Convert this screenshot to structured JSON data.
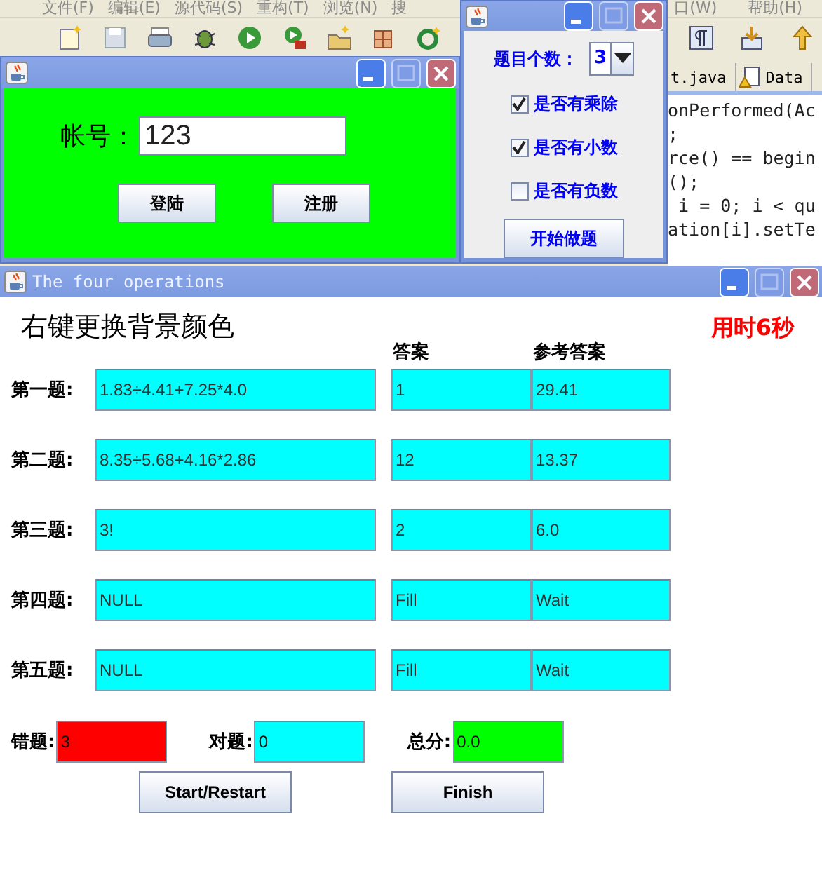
{
  "ide": {
    "menu_left": [
      "文件(F)",
      "编辑(E)",
      "源代码(S)",
      "重构(T)",
      "浏览(N)",
      "搜"
    ],
    "menu_right": [
      "口(W)",
      "帮助(H)"
    ],
    "tabs": [
      "t.java",
      "Data"
    ],
    "code_lines": [
      "onPerformed(Ac",
      ";",
      "rce() == begin",
      "();",
      " i = 0; i < qu",
      "ation[i].setTe"
    ]
  },
  "login_window": {
    "account_label": "帐号：",
    "account_value": "123",
    "buttons": [
      "登陆",
      "注册"
    ]
  },
  "settings_window": {
    "count_label": "题目个数：",
    "count_value": "3",
    "options": [
      {
        "label": "是否有乘除",
        "checked": true
      },
      {
        "label": "是否有小数",
        "checked": true
      },
      {
        "label": "是否有负数",
        "checked": false
      }
    ],
    "start_button": "开始做题"
  },
  "main_window": {
    "title": "The four operations",
    "hint": "右键更换背景颜色",
    "timer": "用时6秒",
    "columns": [
      "答案",
      "参考答案"
    ],
    "questions": [
      {
        "label": "第一题:",
        "expression": "1.83÷4.41+7.25*4.0",
        "answer": "1",
        "reference": "29.41"
      },
      {
        "label": "第二题:",
        "expression": "8.35÷5.68+4.16*2.86",
        "answer": "12",
        "reference": "13.37"
      },
      {
        "label": "第三题:",
        "expression": "3!",
        "answer": "2",
        "reference": "6.0"
      },
      {
        "label": "第四题:",
        "expression": "NULL",
        "answer": "Fill",
        "reference": "Wait"
      },
      {
        "label": "第五题:",
        "expression": "NULL",
        "answer": "Fill",
        "reference": "Wait"
      }
    ],
    "stats": [
      {
        "label": "错题:",
        "value": "3",
        "color": "#ff0000"
      },
      {
        "label": "对题:",
        "value": "0",
        "color": "#00ffff"
      },
      {
        "label": "总分:",
        "value": "0.0",
        "color": "#00ff00"
      }
    ],
    "buttons": [
      "Start/Restart",
      "Finish"
    ]
  }
}
